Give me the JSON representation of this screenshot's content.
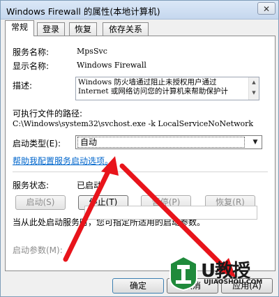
{
  "window": {
    "title": "Windows Firewall 的属性(本地计算机)",
    "close_glyph": "✕"
  },
  "tabs": [
    {
      "label": "常规"
    },
    {
      "label": "登录"
    },
    {
      "label": "恢复"
    },
    {
      "label": "依存关系"
    }
  ],
  "general": {
    "service_name_label": "服务名称:",
    "service_name_value": "MpsSvc",
    "display_name_label": "显示名称:",
    "display_name_value": "Windows Firewall",
    "description_label": "描述:",
    "description_line1": "Windows 防火墙通过阻止未授权用户通过",
    "description_line2": "Internet 或网络访问您的计算机来帮助保护计",
    "exe_path_label": "可执行文件的路径:",
    "exe_path_value": "C:\\Windows\\system32\\svchost.exe -k LocalServiceNoNetwork",
    "startup_type_label": "启动类型(E):",
    "startup_type_value": "自动",
    "help_link": "帮助我配置服务启动选项。",
    "service_status_label": "服务状态:",
    "service_status_value": "已启动",
    "start_button": "启动(S)",
    "stop_button": "停止(T)",
    "pause_button": "暂停(P)",
    "resume_button": "恢复(R)",
    "hint_text": "当从此处启动服务时，您可指定所适用的启动参数。",
    "start_params_label": "启动参数(M):",
    "start_params_value": ""
  },
  "buttons": {
    "ok": "确定",
    "cancel": "取消",
    "apply": "应用(A)"
  },
  "watermark": {
    "brand": "U教授",
    "domain": "UJIAOSHOU.COM"
  },
  "colors": {
    "arrow": "#e8141b",
    "link": "#0066cc",
    "watermark_green": "#1f8a3b"
  }
}
